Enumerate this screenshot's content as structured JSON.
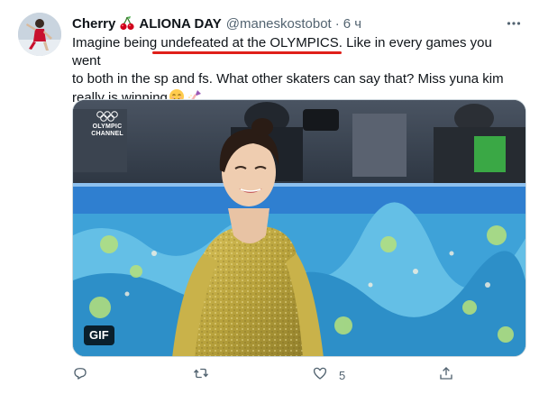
{
  "tweet": {
    "display_name_prefix": "Cherry",
    "display_name_suffix": "ALIONA DAY",
    "handle": "@maneskostobot",
    "separator": "·",
    "time": "6 ч",
    "text_line1_before": "Imagine being ",
    "text_line1_underlined": "undefeated at the OLYMPICS",
    "text_line1_after": ". Like in every games you went",
    "text_line2": "to both in the sp and fs. What other skaters can say that? Miss yuna kim",
    "text_line3": "really is winning",
    "media": {
      "badge": "GIF",
      "watermark_top": "OLYMPIC",
      "watermark_bottom": "CHANNEL"
    },
    "actions": {
      "reply_count": "",
      "retweet_count": "",
      "like_count": "5",
      "share_count": ""
    }
  },
  "colors": {
    "text": "#0f1419",
    "secondary": "#536471",
    "annotation_underline": "#e0201a",
    "action_icon": "#536471"
  },
  "icons": {
    "cherry": "cherry-emoji",
    "more": "more-dots-icon",
    "reply": "reply-icon",
    "retweet": "retweet-icon",
    "like": "heart-icon",
    "share": "share-icon"
  }
}
